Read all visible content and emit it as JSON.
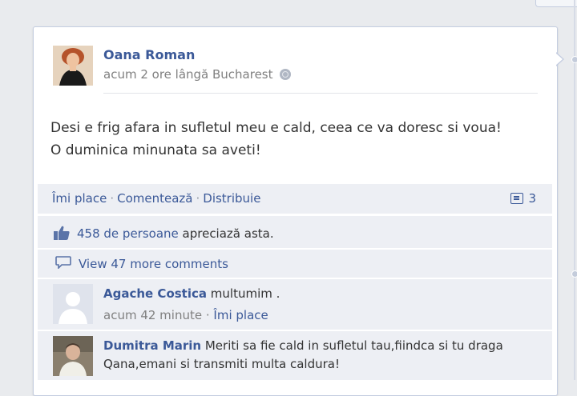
{
  "post": {
    "author": "Oana Roman",
    "meta": "acum 2 ore lângă Bucharest",
    "text_line1": "Desi e frig afara in sufletul meu e cald, ceea ce va doresc si voua!",
    "text_line2": "O duminica minunata sa aveti!",
    "privacy_icon": "globe-icon"
  },
  "actions": {
    "like": "Îmi place",
    "comment": "Comentează",
    "share": "Distribuie",
    "separator": "·",
    "comment_count": "3"
  },
  "likes": {
    "count_link": "458 de persoane",
    "suffix": " apreciază asta."
  },
  "view_comments": "View 47 more comments",
  "comments": [
    {
      "name": "Agache Costica",
      "text": " multumim .",
      "time": "acum 42 minute",
      "separator": " · ",
      "like": "Îmi place"
    },
    {
      "name": "Dumitra Marin",
      "text": " Meriti sa fie cald in sufletul tau,fiindca si tu draga Qana,emani si transmiti multa caldura!"
    }
  ],
  "colors": {
    "link": "#3b5998",
    "row_bg": "#edeff4",
    "muted": "#808080"
  }
}
